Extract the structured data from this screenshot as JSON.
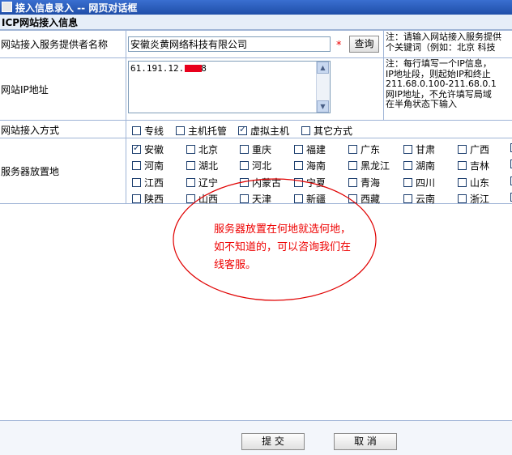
{
  "window": {
    "title": "接入信息录入 -- 网页对话框"
  },
  "section": {
    "title": "ICP网站接入信息"
  },
  "provider": {
    "label": "网站接入服务提供者名称",
    "value": "安徽炎黄网络科技有限公司",
    "required_mark": "*",
    "query_button": "查询",
    "note_lines": [
      "注：请输入网站接入服务提供",
      "个关键词（例如：北京 科技"
    ]
  },
  "ip": {
    "label": "网站IP地址",
    "value": "61.191.12.",
    "value_tail": "8",
    "note_lines": [
      "注：每行填写一个IP信息，",
      "IP地址段，则起始IP和终止",
      "211.68.0.100-211.68.0.1",
      "网IP地址，不允许填写局域",
      "在半角状态下输入"
    ]
  },
  "access_method": {
    "label": "网站接入方式",
    "options": [
      {
        "label": "专线",
        "checked": false
      },
      {
        "label": "主机托管",
        "checked": false
      },
      {
        "label": "虚拟主机",
        "checked": true
      },
      {
        "label": "其它方式",
        "checked": false
      }
    ]
  },
  "server_location": {
    "label": "服务器放置地",
    "rows": [
      [
        {
          "label": "安徽",
          "checked": true
        },
        {
          "label": "北京",
          "checked": false
        },
        {
          "label": "重庆",
          "checked": false
        },
        {
          "label": "福建",
          "checked": false
        },
        {
          "label": "广东",
          "checked": false
        },
        {
          "label": "甘肃",
          "checked": false
        },
        {
          "label": "广西",
          "checked": false
        }
      ],
      [
        {
          "label": "河南",
          "checked": false
        },
        {
          "label": "湖北",
          "checked": false
        },
        {
          "label": "河北",
          "checked": false
        },
        {
          "label": "海南",
          "checked": false
        },
        {
          "label": "黑龙江",
          "checked": false
        },
        {
          "label": "湖南",
          "checked": false
        },
        {
          "label": "吉林",
          "checked": false
        }
      ],
      [
        {
          "label": "江西",
          "checked": false
        },
        {
          "label": "辽宁",
          "checked": false
        },
        {
          "label": "内蒙古",
          "checked": false
        },
        {
          "label": "宁夏",
          "checked": false
        },
        {
          "label": "青海",
          "checked": false
        },
        {
          "label": "四川",
          "checked": false
        },
        {
          "label": "山东",
          "checked": false
        }
      ],
      [
        {
          "label": "陕西",
          "checked": false
        },
        {
          "label": "山西",
          "checked": false
        },
        {
          "label": "天津",
          "checked": false
        },
        {
          "label": "新疆",
          "checked": false
        },
        {
          "label": "西藏",
          "checked": false
        },
        {
          "label": "云南",
          "checked": false
        },
        {
          "label": "浙江",
          "checked": false
        }
      ]
    ]
  },
  "annotation": {
    "text": "服务器放置在何地就选何地，如不知道的，可以咨询我们在线客服。"
  },
  "footer": {
    "submit": "提 交",
    "cancel": "取 消"
  },
  "colors": {
    "titlebar": "#2a5cc0",
    "annotation": "#e00000",
    "border": "#9fb4d6"
  }
}
